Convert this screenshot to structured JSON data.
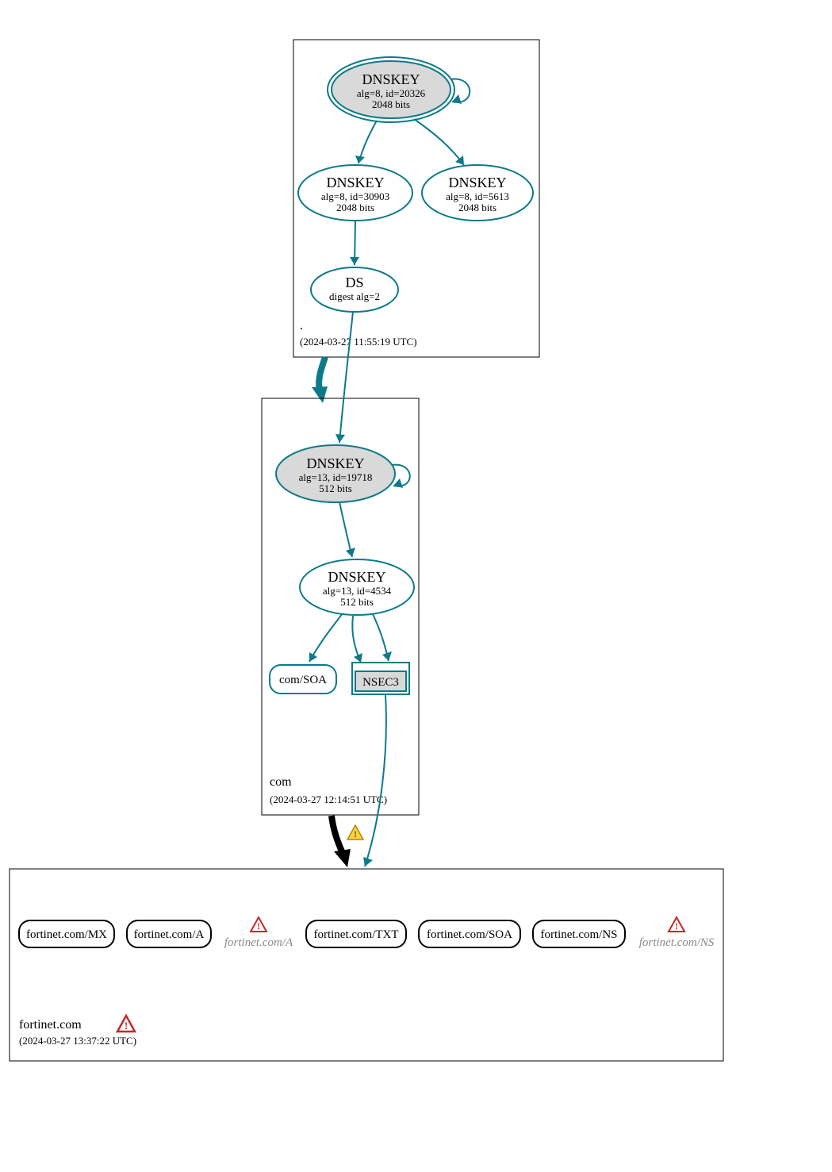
{
  "zones": {
    "root": {
      "label": ".",
      "timestamp": "(2024-03-27 11:55:19 UTC)",
      "nodes": {
        "ksk": {
          "title": "DNSKEY",
          "line1": "alg=8, id=20326",
          "line2": "2048 bits"
        },
        "zsk1": {
          "title": "DNSKEY",
          "line1": "alg=8, id=30903",
          "line2": "2048 bits"
        },
        "zsk2": {
          "title": "DNSKEY",
          "line1": "alg=8, id=5613",
          "line2": "2048 bits"
        },
        "ds": {
          "title": "DS",
          "line1": "digest alg=2"
        }
      }
    },
    "com": {
      "label": "com",
      "timestamp": "(2024-03-27 12:14:51 UTC)",
      "nodes": {
        "ksk": {
          "title": "DNSKEY",
          "line1": "alg=13, id=19718",
          "line2": "512 bits"
        },
        "zsk": {
          "title": "DNSKEY",
          "line1": "alg=13, id=4534",
          "line2": "512 bits"
        },
        "soa": {
          "label": "com/SOA"
        },
        "nsec3": {
          "label": "NSEC3"
        }
      }
    },
    "leaf": {
      "label": "fortinet.com",
      "timestamp": "(2024-03-27 13:37:22 UTC)",
      "rr": [
        {
          "label": "fortinet.com/MX",
          "status": "ok"
        },
        {
          "label": "fortinet.com/A",
          "status": "ok"
        },
        {
          "label": "fortinet.com/A",
          "status": "error"
        },
        {
          "label": "fortinet.com/TXT",
          "status": "ok"
        },
        {
          "label": "fortinet.com/SOA",
          "status": "ok"
        },
        {
          "label": "fortinet.com/NS",
          "status": "ok"
        },
        {
          "label": "fortinet.com/NS",
          "status": "error"
        }
      ]
    }
  },
  "icons": {
    "warning": "warning-icon",
    "error": "error-icon"
  }
}
